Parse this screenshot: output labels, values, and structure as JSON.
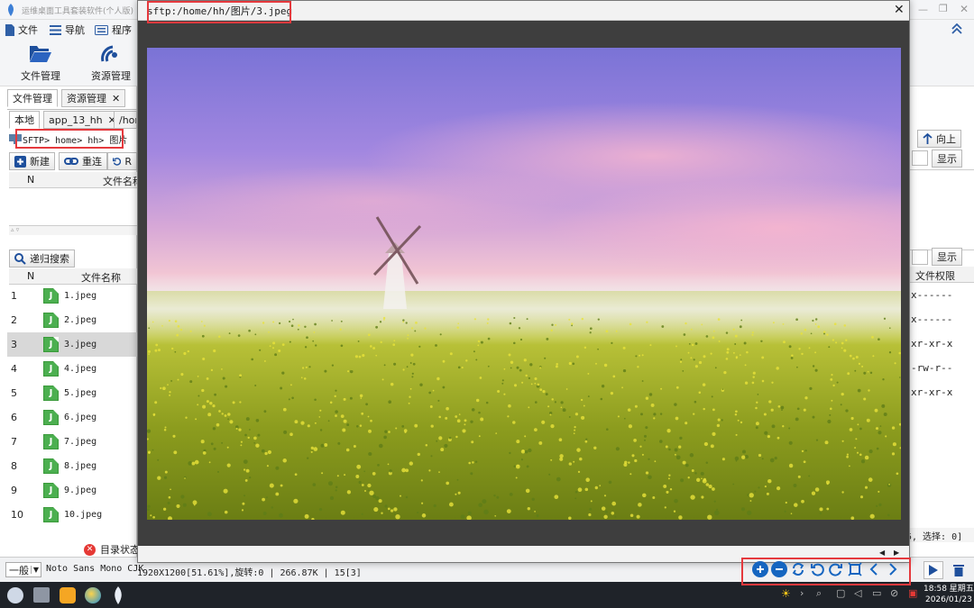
{
  "window": {
    "title": "运维桌面工具套装软件(个人版)"
  },
  "menu": {
    "file": "文件",
    "nav": "导航",
    "program": "程序"
  },
  "toolbar": {
    "file_mgr": "文件管理",
    "res_mgr": "资源管理"
  },
  "main_tabs": [
    "文件管理",
    "资源管理"
  ],
  "session_tabs": {
    "local": "本地",
    "remote": "app_13_hh",
    "path_partial": "/hor"
  },
  "breadcrumb": "SFTP> home> hh> 图片",
  "actions": {
    "new": "新建",
    "reconnect": "重连",
    "refresh_partial": "R"
  },
  "upper_table": {
    "col_n": "N",
    "col_name": "文件名称"
  },
  "search_button": "递归搜索",
  "lower_table": {
    "col_n": "N",
    "col_name": "文件名称"
  },
  "files": [
    {
      "n": "1",
      "name": "1.jpeg"
    },
    {
      "n": "2",
      "name": "2.jpeg"
    },
    {
      "n": "3",
      "name": "3.jpeg"
    },
    {
      "n": "4",
      "name": "4.jpeg"
    },
    {
      "n": "5",
      "name": "5.jpeg"
    },
    {
      "n": "6",
      "name": "6.jpeg"
    },
    {
      "n": "7",
      "name": "7.jpeg"
    },
    {
      "n": "8",
      "name": "8.jpeg"
    },
    {
      "n": "9",
      "name": "9.jpeg"
    },
    {
      "n": "10",
      "name": "10.jpeg"
    }
  ],
  "selected_file_index": 2,
  "dir_status": "目录状态",
  "right_panel": {
    "up_button": "向上",
    "show_button": "显示",
    "show_button_2": "显示",
    "col_perm": "文件权限",
    "perms": [
      "x------",
      "x------",
      "xr-xr-x",
      "-rw-r--",
      "xr-xr-x"
    ],
    "selection_info": "5, 选择: 0]"
  },
  "status": {
    "combo_value": "一般",
    "font_value": "Noto Sans Mono CJK"
  },
  "viewer": {
    "path": "sftp:/home/hh/图片/3.jpeg",
    "info": "1920X1200[51.61%],旋转:0 | 266.87K | 15[3]",
    "controls": [
      "zoom-in",
      "zoom-out",
      "refresh",
      "rotate-left",
      "rotate-right",
      "fit",
      "previous",
      "next"
    ]
  },
  "taskbar": {
    "time": "18:58 星期五",
    "date": "2026/01/23"
  },
  "colors": {
    "accent": "#1565c0",
    "highlight": "#e5393d",
    "file_icon": "#4caf50"
  }
}
